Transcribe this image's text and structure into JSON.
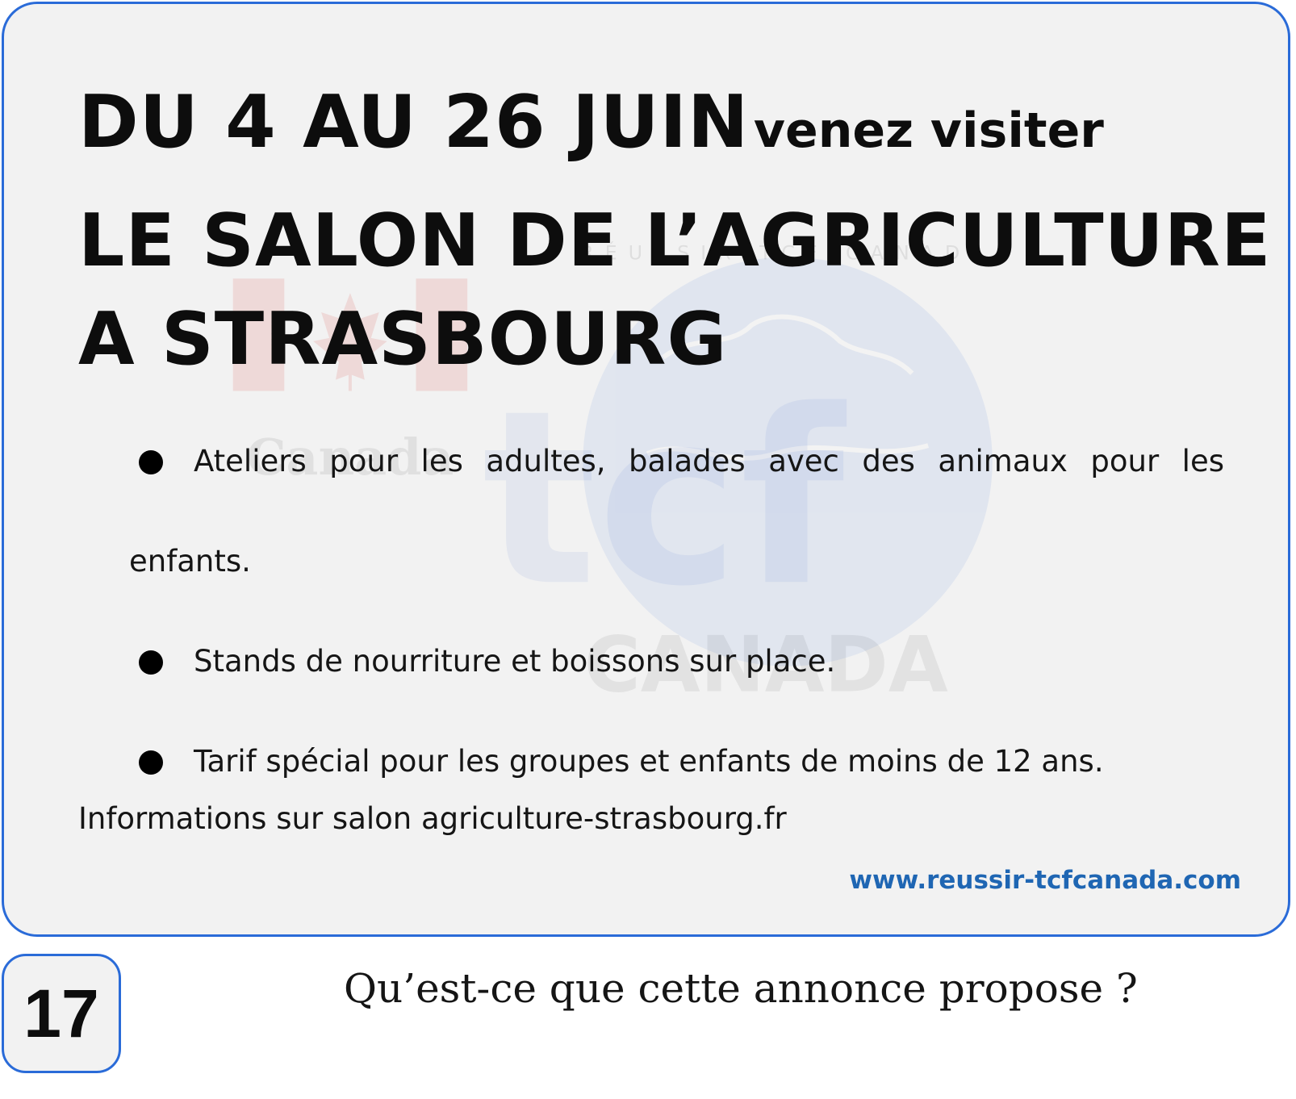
{
  "card": {
    "headline": {
      "line1_big": "DU 4 AU 26 JUIN",
      "line1_small": "venez visiter",
      "line2": "LE SALON DE L’AGRICULTURE",
      "line3": "A STRASBOURG"
    },
    "bullets": [
      "Ateliers pour les adultes, balades avec des animaux pour les enfants.",
      "Stands de nourriture et boissons sur place.",
      "Tarif spécial pour les groupes et enfants de moins de 12 ans."
    ],
    "info": "Informations sur salon agriculture-strasbourg.fr",
    "website": "www.reussir-tcfcanada.com",
    "watermark": {
      "text_top": "Canada",
      "logo_text": "tcf",
      "logo_sub": "CANADA",
      "ring_text": "RÉUSSIR TCF CANADA"
    }
  },
  "question_number": "17",
  "question": "Qu’est-ce que cette annonce propose ?",
  "colors": {
    "border": "#2a6bd8",
    "card_bg": "#f2f2f2",
    "website": "#1f66b3"
  },
  "icons": {
    "bullet": "bullet-dot-icon",
    "canada_flag": "canada-flag-icon",
    "globe": "globe-icon"
  }
}
